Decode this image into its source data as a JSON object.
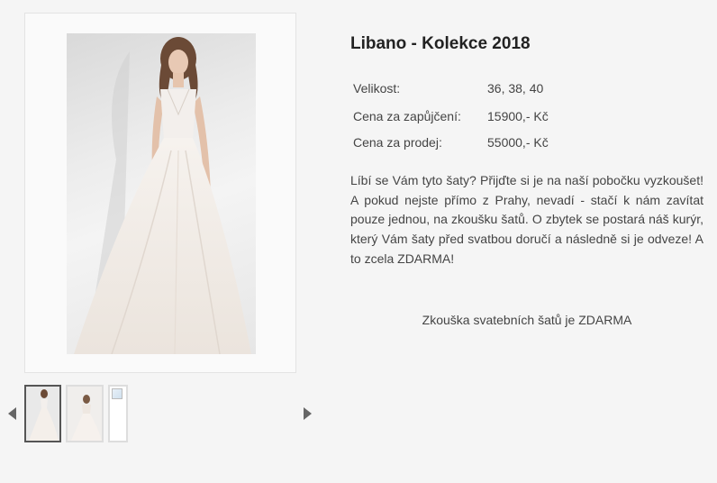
{
  "product": {
    "title": "Libano - Kolekce 2018",
    "specs": [
      {
        "label": "Velikost:",
        "value": "36, 38, 40"
      },
      {
        "label": "Cena za zapůjčení:",
        "value": "15900,- Kč"
      },
      {
        "label": "Cena za prodej:",
        "value": "55000,- Kč"
      }
    ],
    "description": "Líbí se Vám tyto šaty? Přijďte si je na naší pobočku vyzkoušet! A pokud nejste přímo z Prahy, nevadí - stačí k nám zavítat pouze jednou, na zkoušku šatů. O zbytek se postará náš kurýr, který Vám šaty před svatbou doručí a následně si je odveze! A to zcela ZDARMA!",
    "free_note": "Zkouška svatebních šatů je ZDARMA"
  },
  "gallery": {
    "prev_icon": "arrow-left-icon",
    "next_icon": "arrow-right-icon",
    "thumbnail_count": 3,
    "selected_index": 0
  },
  "colors": {
    "background": "#f5f5f5",
    "text": "#444444",
    "title": "#222222",
    "selected_border": "#555555"
  }
}
